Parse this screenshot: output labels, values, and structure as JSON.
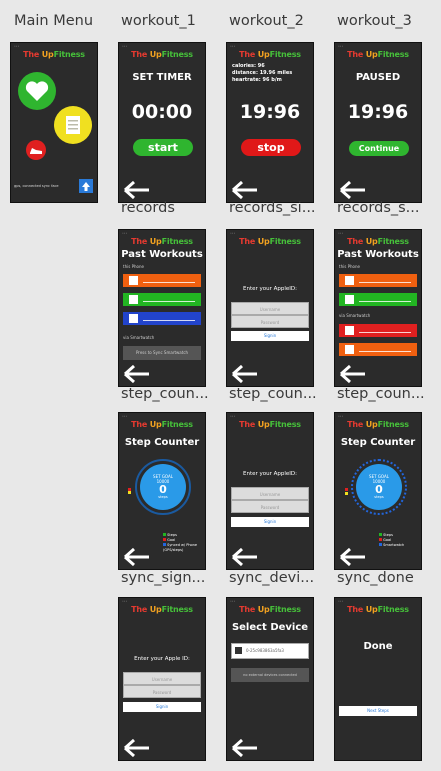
{
  "labels": [
    "Main Menu",
    "workout_1",
    "workout_2",
    "workout_3",
    "records",
    "records_si...",
    "records_s...",
    "step_coun...",
    "step_coun...",
    "step_coun...",
    "sync_sign...",
    "sync_devi...",
    "sync_done"
  ],
  "brand": {
    "a": "The ",
    "b": "Up",
    "c": "Fitness"
  },
  "main_menu": {
    "footer": "gps, connected sync face"
  },
  "workout_1": {
    "title": "SET TIMER",
    "time": "00:00",
    "button": "start",
    "button_color": "#2fb52f"
  },
  "workout_2": {
    "stats": [
      "calories: 96",
      "distance: 19.96 miles",
      "heartrate: 96 b/m"
    ],
    "time": "19:96",
    "button": "stop",
    "button_color": "#e01818"
  },
  "workout_3": {
    "title": "PAUSED",
    "time": "19:96",
    "button": "Continue",
    "button_color": "#2fb52f"
  },
  "records": {
    "title": "Past Workouts",
    "section1": "this Phone",
    "section2": "via Smartwatch",
    "sync_button": "Press to Sync Smartwatch",
    "rows": [
      "#f06010",
      "#22b522",
      "#2244cc"
    ]
  },
  "records_si": {
    "prompt": "Enter your AppleID:",
    "username": "Username",
    "password": "Password",
    "signin": "Signin"
  },
  "records_s": {
    "title": "Past Workouts",
    "section1": "this Phone",
    "section2": "via Smartwatch",
    "rows_a": [
      "#f06010",
      "#22b522"
    ],
    "rows_b": [
      "#e02020",
      "#f06010"
    ]
  },
  "step_counter_1": {
    "title": "Step Counter",
    "goal_label": "SET GOAL",
    "goal": "10000",
    "steps": "0",
    "steps_label": "steps",
    "legend": [
      "Steps",
      "Goal",
      "Synced w/ Phone (GPS/steps)"
    ],
    "legend_colors": [
      "#22b522",
      "#e02020",
      "#2266dd"
    ]
  },
  "step_counter_2": {
    "prompt": "Enter your AppleID:",
    "username": "Username",
    "password": "Password",
    "signin": "Signin"
  },
  "step_counter_3": {
    "title": "Step Counter",
    "goal_label": "SET GOAL",
    "goal": "10000",
    "steps": "0",
    "steps_label": "steps",
    "legend": [
      "Steps",
      "Goal",
      "Smartwatch"
    ],
    "legend_colors": [
      "#22b522",
      "#e02020",
      "#2266dd"
    ]
  },
  "sync_sign": {
    "prompt": "Enter your Apple ID:",
    "username": "Username",
    "password": "Password",
    "signin": "Signin"
  },
  "sync_devi": {
    "title": "Select Device",
    "device": "0-25c983863a5fa3",
    "status": "no external devices connected"
  },
  "sync_done": {
    "title": "Done",
    "button": "Next Steps"
  }
}
